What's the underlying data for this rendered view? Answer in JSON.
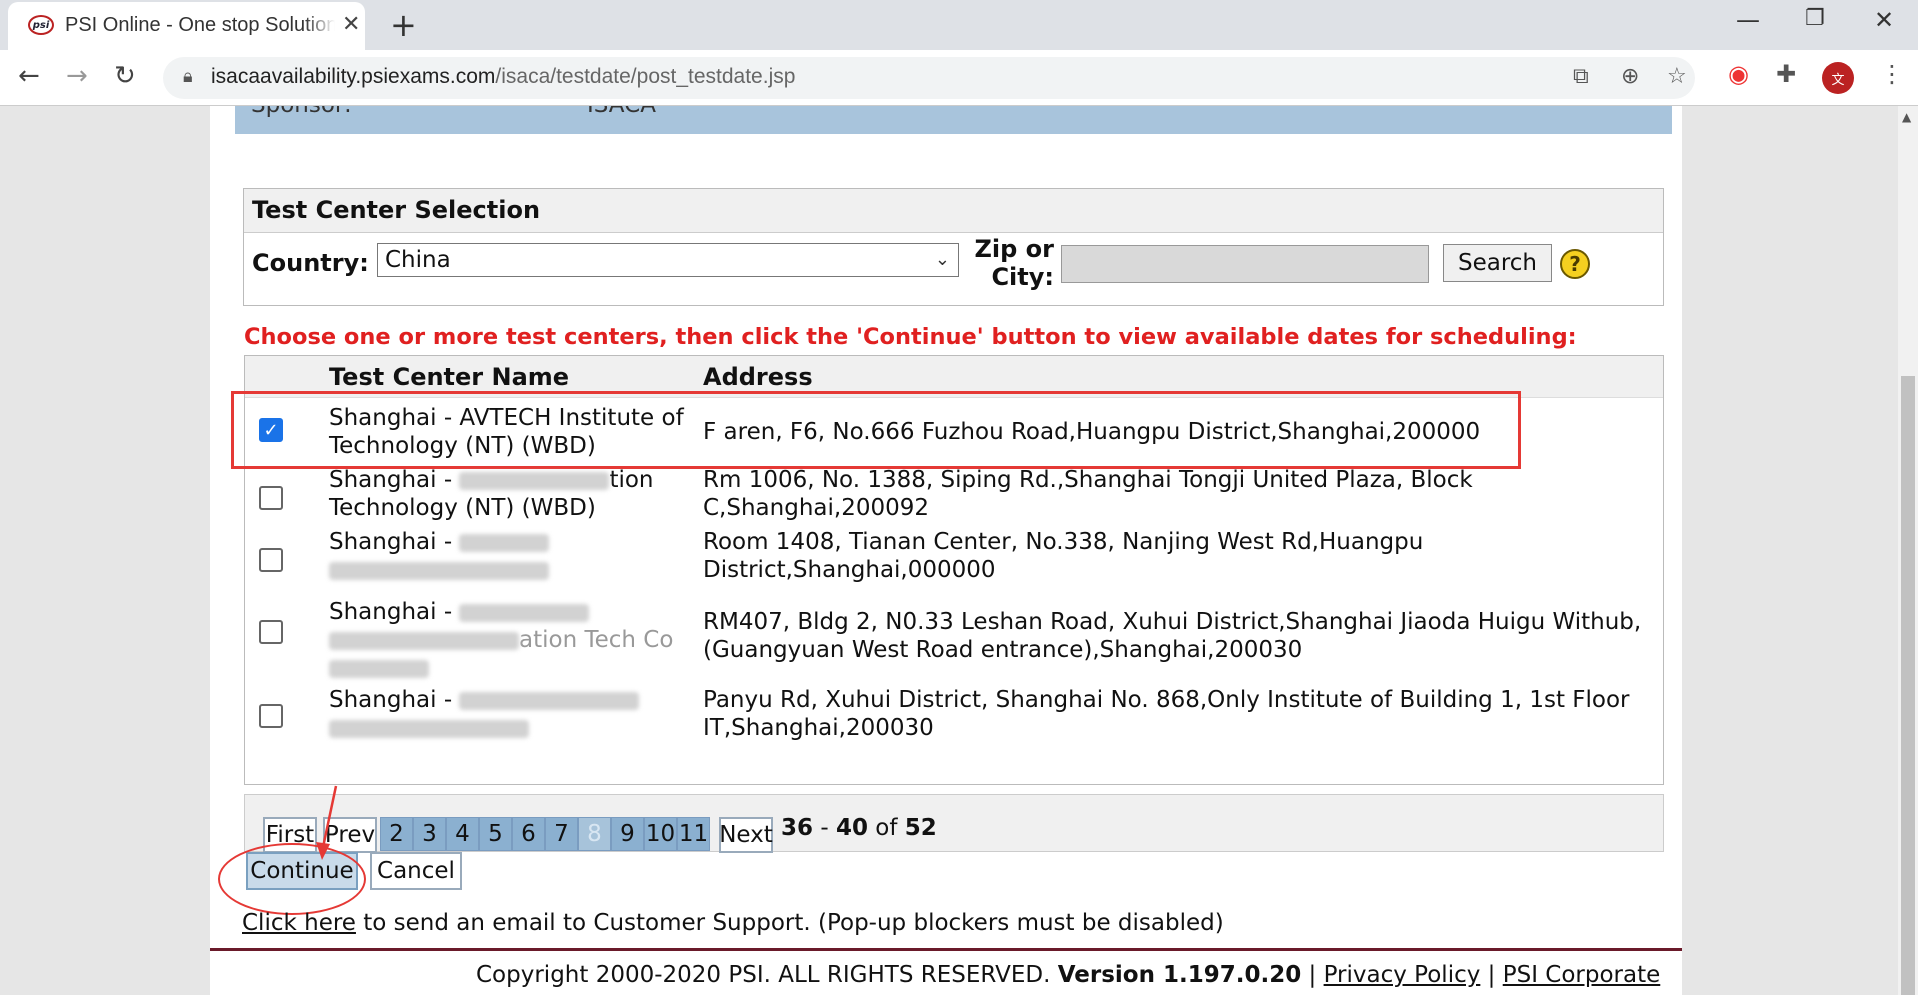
{
  "browser": {
    "tab_title": "PSI Online - One stop Solution",
    "tab_favicon": "psi",
    "url_host": "isacaavailability.psiexams.com",
    "url_path": "/isaca/testdate/post_testdate.jsp"
  },
  "sponsor": {
    "label": "Sponsor:",
    "value": "ISACA"
  },
  "test_center": {
    "title": "Test Center Selection",
    "country_label": "Country:",
    "country_value": "China",
    "zip_label": "Zip or City:",
    "zip_value": "",
    "search_label": "Search",
    "help_glyph": "?"
  },
  "instructions": "Choose one or more test centers, then click the 'Continue' button to view available dates for scheduling:",
  "table": {
    "headers": {
      "name": "Test Center Name",
      "address": "Address"
    },
    "rows": [
      {
        "name": "Shanghai - AVTECH Institute of Technology (NT) (WBD)",
        "address": "F aren, F6, No.666 Fuzhou Road,Huangpu District,Shanghai,200000",
        "checked": true
      },
      {
        "name_prefix": "Shanghai -",
        "name_suffix": "tion",
        "name_line2": "Technology (NT) (WBD)",
        "address": "Rm 1006, No. 1388, Siping Rd.,Shanghai Tongji United Plaza, Block C,Shanghai,200092",
        "checked": false
      },
      {
        "name_prefix": "Shanghai -",
        "address": "Room 1408, Tianan Center, No.338, Nanjing West Rd,Huangpu District,Shanghai,000000",
        "checked": false
      },
      {
        "name_prefix": "Shanghai -",
        "name_suffix": "ation Tech Co",
        "address": "RM407, Bldg 2, N0.33 Leshan Road, Xuhui District,Shanghai Jiaoda Huigu Withub, (Guangyuan West Road entrance),Shanghai,200030",
        "checked": false
      },
      {
        "name_prefix": "Shanghai -",
        "address": "Panyu Rd, Xuhui District, Shanghai No. 868,Only Institute of Building 1, 1st Floor IT,Shanghai,200030",
        "checked": false
      }
    ]
  },
  "pager": {
    "first": "First",
    "prev": "Prev",
    "pages": [
      "2",
      "3",
      "4",
      "5",
      "6",
      "7",
      "8",
      "9",
      "10",
      "11"
    ],
    "current_page": "8",
    "next": "Next",
    "range_start": "36",
    "range_sep": "-",
    "range_end": "40",
    "of_label": "of",
    "total": "52"
  },
  "actions": {
    "continue": "Continue",
    "cancel": "Cancel"
  },
  "support": {
    "link": "Click here",
    "text": " to send an email to Customer Support. (Pop-up blockers must be disabled)"
  },
  "footer": {
    "copyright": "Copyright 2000-2020 PSI. ALL RIGHTS RESERVED.",
    "version": "Version 1.197.0.20",
    "sep": "|",
    "privacy": "Privacy Policy",
    "corporate": "PSI Corporate"
  },
  "colors": {
    "accent_red": "#e02020",
    "sponsor_bar": "#a8c4dc",
    "page_button": "#8bb0d0",
    "footer_rule": "#6a1a2a"
  }
}
